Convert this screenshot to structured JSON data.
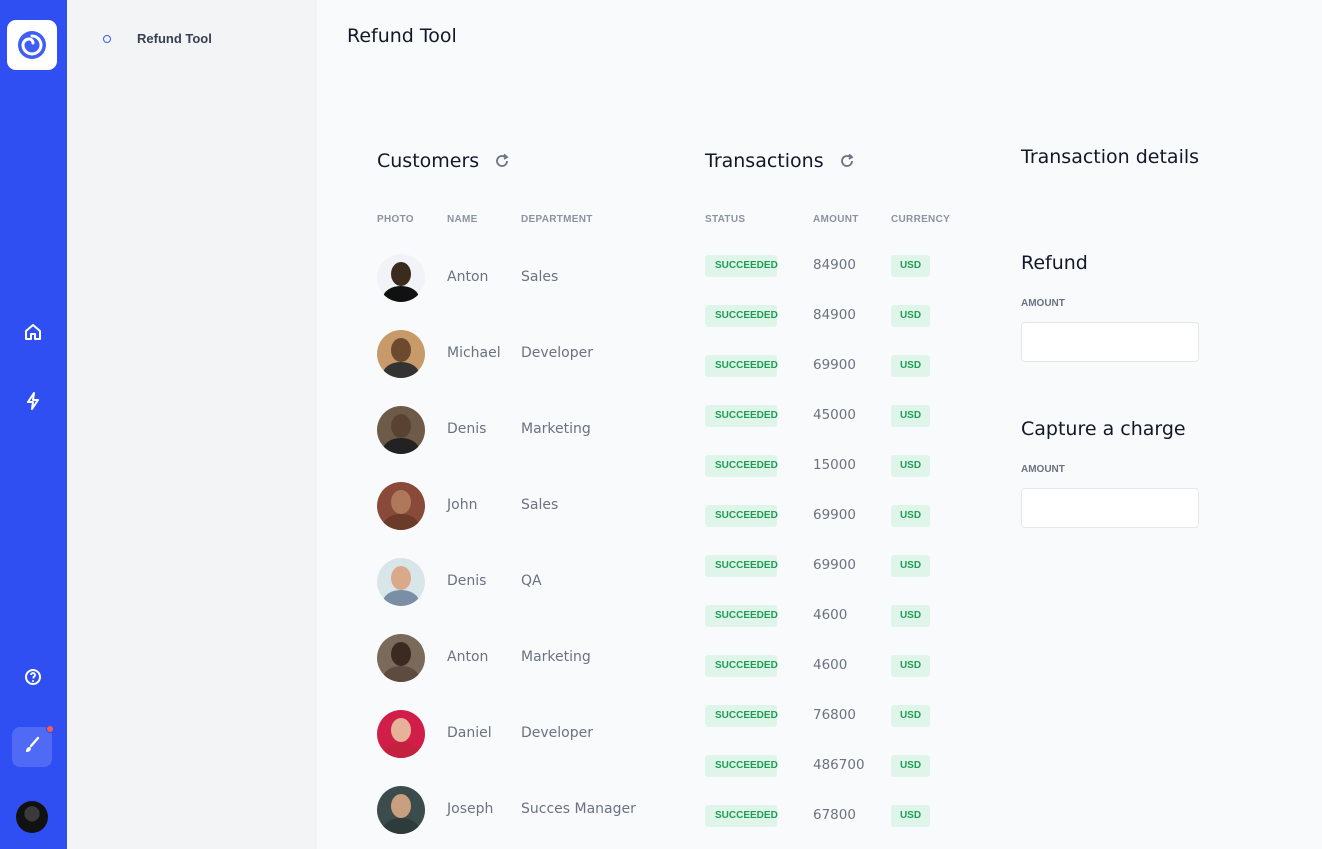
{
  "nav": {
    "panel_item": "Refund Tool"
  },
  "page": {
    "title": "Refund Tool"
  },
  "customers": {
    "title": "Customers",
    "headers": {
      "photo": "PHOTO",
      "name": "NAME",
      "department": "DEPARTMENT"
    },
    "rows": [
      {
        "name": "Anton",
        "department": "Sales"
      },
      {
        "name": "Michael",
        "department": "Developer"
      },
      {
        "name": "Denis",
        "department": "Marketing"
      },
      {
        "name": "John",
        "department": "Sales"
      },
      {
        "name": "Denis",
        "department": "QA"
      },
      {
        "name": "Anton",
        "department": "Marketing"
      },
      {
        "name": "Daniel",
        "department": "Developer"
      },
      {
        "name": "Joseph",
        "department": "Succes Manager"
      }
    ]
  },
  "transactions": {
    "title": "Transactions",
    "headers": {
      "status": "STATUS",
      "amount": "AMOUNT",
      "currency": "CURRENCY"
    },
    "rows": [
      {
        "status": "SUCCEEDED",
        "amount": "84900",
        "currency": "USD"
      },
      {
        "status": "SUCCEEDED",
        "amount": "84900",
        "currency": "USD"
      },
      {
        "status": "SUCCEEDED",
        "amount": "69900",
        "currency": "USD"
      },
      {
        "status": "SUCCEEDED",
        "amount": "45000",
        "currency": "USD"
      },
      {
        "status": "SUCCEEDED",
        "amount": "15000",
        "currency": "USD"
      },
      {
        "status": "SUCCEEDED",
        "amount": "69900",
        "currency": "USD"
      },
      {
        "status": "SUCCEEDED",
        "amount": "69900",
        "currency": "USD"
      },
      {
        "status": "SUCCEEDED",
        "amount": "4600",
        "currency": "USD"
      },
      {
        "status": "SUCCEEDED",
        "amount": "4600",
        "currency": "USD"
      },
      {
        "status": "SUCCEEDED",
        "amount": "76800",
        "currency": "USD"
      },
      {
        "status": "SUCCEEDED",
        "amount": "486700",
        "currency": "USD"
      },
      {
        "status": "SUCCEEDED",
        "amount": "67800",
        "currency": "USD"
      }
    ]
  },
  "details": {
    "title": "Transaction details",
    "refund": {
      "title": "Refund",
      "amount_label": "AMOUNT",
      "amount_value": ""
    },
    "capture": {
      "title": "Capture a charge",
      "amount_label": "AMOUNT",
      "amount_value": ""
    }
  },
  "icons": {
    "logo": "swirl-logo-icon",
    "home": "home-icon",
    "bolt": "lightning-icon",
    "help": "question-circle-icon",
    "brush": "brush-icon",
    "refresh": "refresh-icon"
  },
  "colors": {
    "rail": "#2f4ff2",
    "success_bg": "#e0f5ea",
    "success_text": "#1f9d55",
    "notification": "#ff5a4f"
  }
}
